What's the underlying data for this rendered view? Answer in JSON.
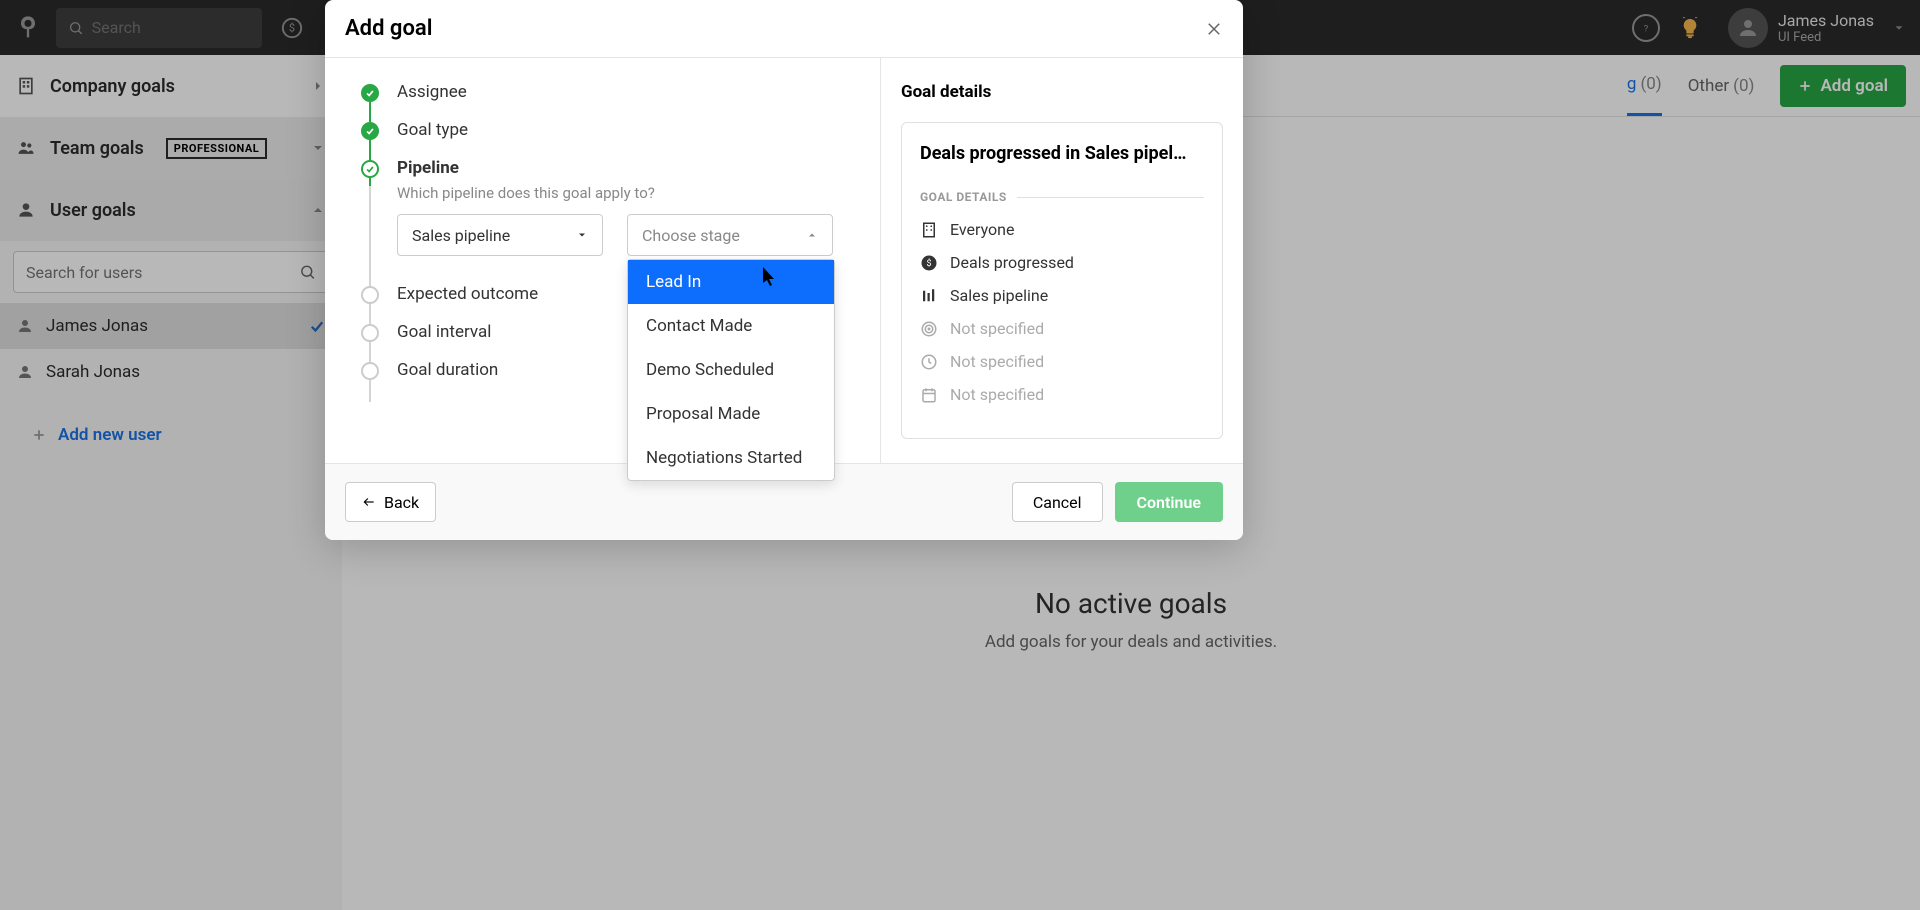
{
  "header": {
    "search_placeholder": "Search",
    "user_name": "James Jonas",
    "user_subtitle": "UI Feed"
  },
  "sidebar": {
    "company_label": "Company goals",
    "team_label": "Team goals",
    "team_badge": "PROFESSIONAL",
    "user_label": "User goals",
    "search_placeholder": "Search for users",
    "users": [
      {
        "name": "James Jonas",
        "active": true
      },
      {
        "name": "Sarah Jonas",
        "active": false
      }
    ],
    "add_user": "Add new user"
  },
  "main": {
    "tabs": {
      "unknown_label": "g",
      "unknown_count": "(0)",
      "other_label": "Other",
      "other_count": "(0)"
    },
    "add_goal_btn": "Add goal",
    "empty_title": "No active goals",
    "empty_subtitle": "Add goals for your deals and activities."
  },
  "modal": {
    "title": "Add goal",
    "steps": {
      "assignee": "Assignee",
      "goal_type": "Goal type",
      "pipeline": "Pipeline",
      "pipeline_desc": "Which pipeline does this goal apply to?",
      "pipeline_select": "Sales pipeline",
      "stage_placeholder": "Choose stage",
      "stage_options": [
        "Lead In",
        "Contact Made",
        "Demo Scheduled",
        "Proposal Made",
        "Negotiations Started"
      ],
      "expected_outcome": "Expected outcome",
      "goal_interval": "Goal interval",
      "goal_duration": "Goal duration"
    },
    "details": {
      "heading": "Goal details",
      "card_title": "Deals progressed in Sales pipel…",
      "subheader": "GOAL DETAILS",
      "rows": {
        "everyone": "Everyone",
        "deals_progressed": "Deals progressed",
        "sales_pipeline": "Sales pipeline",
        "not_specified": "Not specified"
      }
    },
    "footer": {
      "back": "Back",
      "cancel": "Cancel",
      "continue": "Continue"
    }
  }
}
